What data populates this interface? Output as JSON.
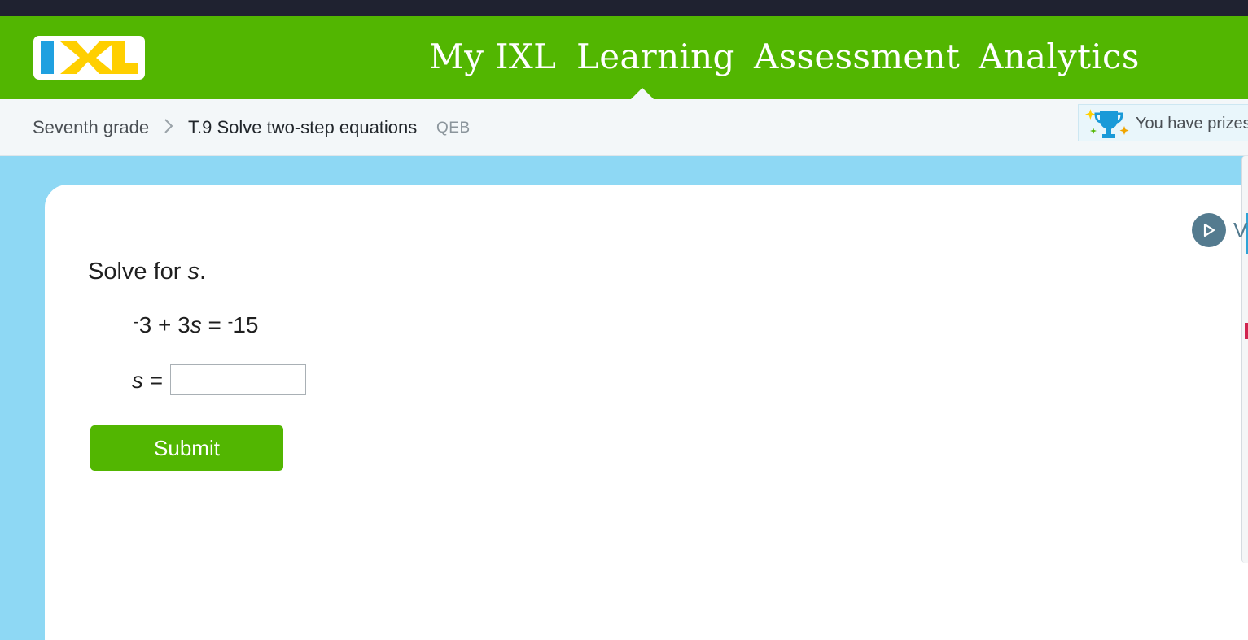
{
  "nav": {
    "logo_text": "IXL",
    "items": [
      {
        "label": "My IXL"
      },
      {
        "label": "Learning",
        "active": true
      },
      {
        "label": "Assessment"
      },
      {
        "label": "Analytics"
      }
    ]
  },
  "breadcrumb": {
    "grade": "Seventh grade",
    "separator_icon": "chevron-right-icon",
    "skill": "T.9 Solve two-step equations",
    "code": "QEB"
  },
  "prizes": {
    "label": "You have prizes",
    "icon": "trophy-icon"
  },
  "video": {
    "icon": "play-icon",
    "label_partial": "V"
  },
  "problem": {
    "prompt_prefix": "Solve for ",
    "variable": "s",
    "prompt_suffix": ".",
    "equation": {
      "term1_sign": "-",
      "term1": "3",
      "op": "+",
      "coef": "3",
      "var": "s",
      "eq": "=",
      "rhs_sign": "-",
      "rhs": "15"
    },
    "answer_label": "s",
    "answer_eq": "=",
    "answer_value": ""
  },
  "submit": {
    "label": "Submit"
  },
  "colors": {
    "brand_green": "#52b601",
    "sky": "#8ed8f4",
    "logo_blue": "#1fa0e0",
    "logo_yellow": "#ffcf00"
  }
}
